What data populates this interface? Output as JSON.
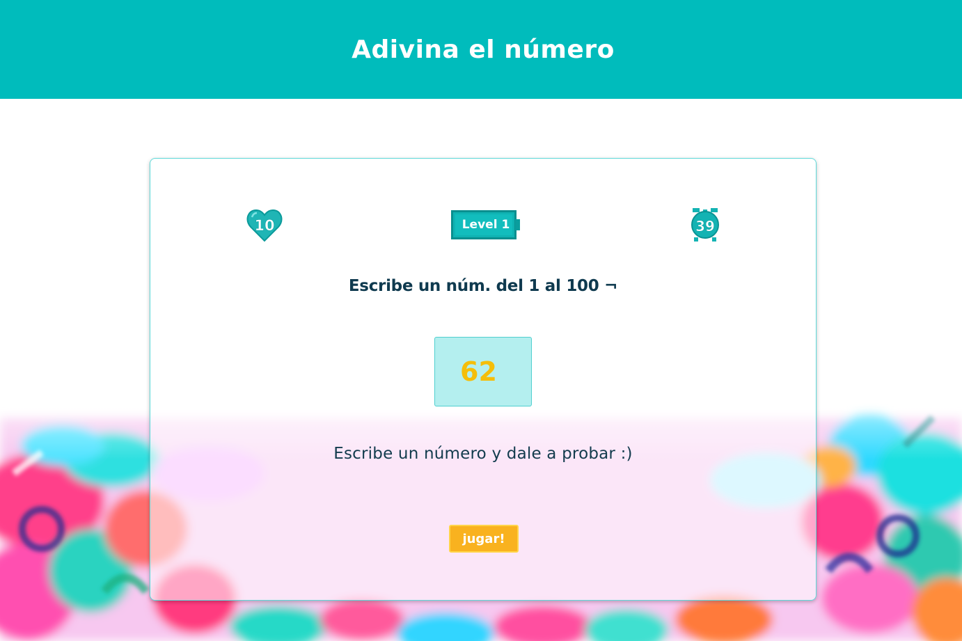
{
  "header": {
    "title": "Adivina el número"
  },
  "stats": {
    "lives": "10",
    "level": "Level 1",
    "timer": "39"
  },
  "game": {
    "prompt": "Escribe un núm. del 1 al 100 ¬",
    "input_value": "62",
    "message": "Escribe un número y dale a probar :)",
    "play_label": "jugar!"
  },
  "colors": {
    "header_bg": "#00bcbc",
    "accent": "#00a9a9",
    "input_bg": "#b4efef",
    "input_text": "#f5be0a",
    "button_bg": "#f9b21f",
    "text_dark": "#0f3a4f"
  },
  "icons": {
    "lives": "heart-icon",
    "level": "battery-icon",
    "timer": "alarm-clock-icon"
  }
}
